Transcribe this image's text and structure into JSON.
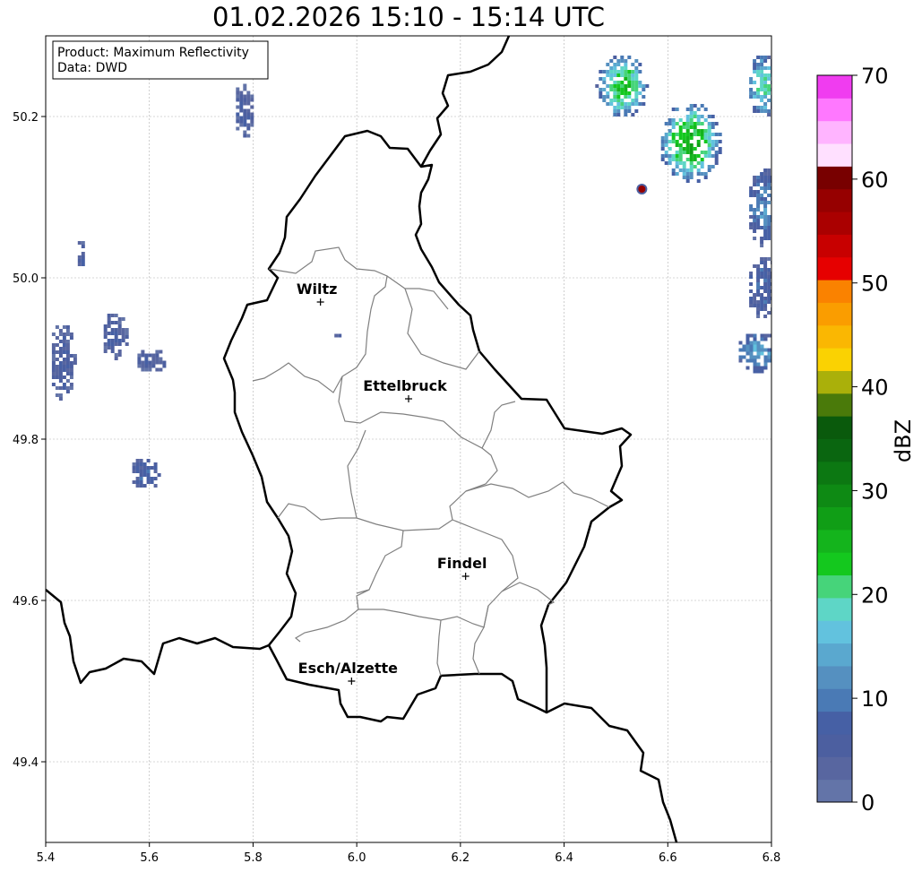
{
  "title": "01.02.2026 15:10 - 15:14 UTC",
  "info": {
    "product_line": "Product: Maximum Reflectivity",
    "data_line": "Data: DWD"
  },
  "axes": {
    "lon_ticks": [
      "5.4",
      "5.6",
      "5.8",
      "6.0",
      "6.2",
      "6.4",
      "6.6",
      "6.8"
    ],
    "lat_ticks": [
      "50.2",
      "50.0",
      "49.8",
      "49.6",
      "49.4"
    ],
    "lon_range": [
      5.4,
      6.8
    ],
    "lat_range": [
      49.3,
      50.3
    ],
    "grid": true
  },
  "cities": [
    {
      "name": "Wiltz",
      "lon": 5.93,
      "lat": 49.97
    },
    {
      "name": "Ettelbruck",
      "lon": 6.1,
      "lat": 49.85
    },
    {
      "name": "Findel",
      "lon": 6.21,
      "lat": 49.63
    },
    {
      "name": "Esch/Alzette",
      "lon": 5.99,
      "lat": 49.5
    }
  ],
  "colorbar": {
    "label": "dBZ",
    "range": [
      0,
      70
    ],
    "tick_labels": [
      "0",
      "10",
      "20",
      "30",
      "40",
      "50",
      "60",
      "70"
    ],
    "colors": [
      "#6374a8",
      "#5866a0",
      "#4c5fa0",
      "#4660a5",
      "#4a7ab5",
      "#5590c0",
      "#5aa8cf",
      "#62c2de",
      "#5ed6c6",
      "#46d47a",
      "#14c81e",
      "#14b41c",
      "#109e16",
      "#0e8a14",
      "#0c7812",
      "#0a6610",
      "#0a5a0c",
      "#4a7a0a",
      "#aab00a",
      "#fad202",
      "#fab702",
      "#fa9d00",
      "#fa8200",
      "#e60000",
      "#c80000",
      "#aa0000",
      "#960000",
      "#780000",
      "#ffe0ff",
      "#ffb4ff",
      "#ff78ff",
      "#f03cf0"
    ]
  },
  "radar_cells": [
    {
      "name": "echo-northeast-1",
      "lon": 6.51,
      "lat": 50.24,
      "rlon": 0.05,
      "rlat": 0.04,
      "dbz": 24
    },
    {
      "name": "echo-northeast-2",
      "lon": 6.64,
      "lat": 50.17,
      "rlon": 0.06,
      "rlat": 0.05,
      "dbz": 26
    },
    {
      "name": "echo-northeast-3",
      "lon": 6.78,
      "lat": 50.24,
      "rlon": 0.03,
      "rlat": 0.04,
      "dbz": 20
    },
    {
      "name": "echo-east-1",
      "lon": 6.78,
      "lat": 50.09,
      "rlon": 0.03,
      "rlat": 0.05,
      "dbz": 12
    },
    {
      "name": "echo-east-2",
      "lon": 6.78,
      "lat": 49.99,
      "rlon": 0.03,
      "rlat": 0.04,
      "dbz": 8
    },
    {
      "name": "echo-east-3",
      "lon": 6.77,
      "lat": 49.91,
      "rlon": 0.04,
      "rlat": 0.025,
      "dbz": 14
    },
    {
      "name": "echo-north-1",
      "lon": 5.78,
      "lat": 50.21,
      "rlon": 0.02,
      "rlat": 0.035,
      "dbz": 6
    },
    {
      "name": "echo-west-1",
      "lon": 5.43,
      "lat": 49.9,
      "rlon": 0.025,
      "rlat": 0.05,
      "dbz": 6
    },
    {
      "name": "echo-west-2",
      "lon": 5.53,
      "lat": 49.93,
      "rlon": 0.025,
      "rlat": 0.03,
      "dbz": 6
    },
    {
      "name": "echo-west-3",
      "lon": 5.6,
      "lat": 49.9,
      "rlon": 0.03,
      "rlat": 0.015,
      "dbz": 6
    },
    {
      "name": "echo-west-4",
      "lon": 5.465,
      "lat": 50.03,
      "rlon": 0.01,
      "rlat": 0.02,
      "dbz": 6
    },
    {
      "name": "echo-west-5",
      "lon": 5.59,
      "lat": 49.76,
      "rlon": 0.03,
      "rlat": 0.02,
      "dbz": 8
    },
    {
      "name": "echo-central-1",
      "lon": 5.96,
      "lat": 49.93,
      "rlon": 0.01,
      "rlat": 0.005,
      "dbz": 6
    }
  ],
  "hotspot": {
    "lon": 6.55,
    "lat": 50.11,
    "dbz": 58
  }
}
